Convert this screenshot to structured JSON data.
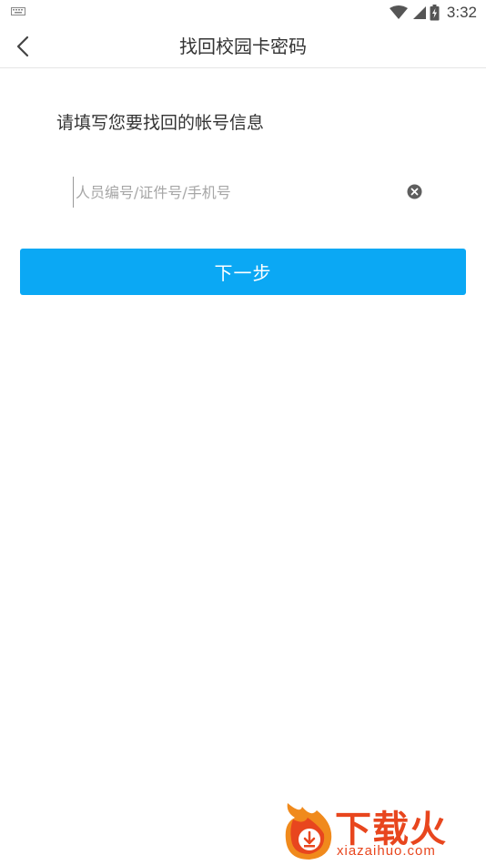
{
  "statusbar": {
    "time": "3:32",
    "icons": [
      "keyboard-icon",
      "wifi-icon",
      "signal-icon",
      "battery-icon"
    ]
  },
  "header": {
    "back_icon": "chevron-left-icon",
    "title": "找回校园卡密码"
  },
  "form": {
    "prompt": "请填写您要找回的帐号信息",
    "account_input": {
      "value": "",
      "placeholder": "人员编号/证件号/手机号"
    },
    "clear_icon": "clear-circle-icon",
    "next_label": "下一步"
  },
  "watermark": {
    "logo_icon": "flame-download-icon",
    "brand": "下载火",
    "domain": "xiazaihuo.com"
  },
  "colors": {
    "accent": "#0ba8f4",
    "title_text": "#333333",
    "placeholder": "#a6a6a6",
    "watermark": "#e8461e"
  }
}
